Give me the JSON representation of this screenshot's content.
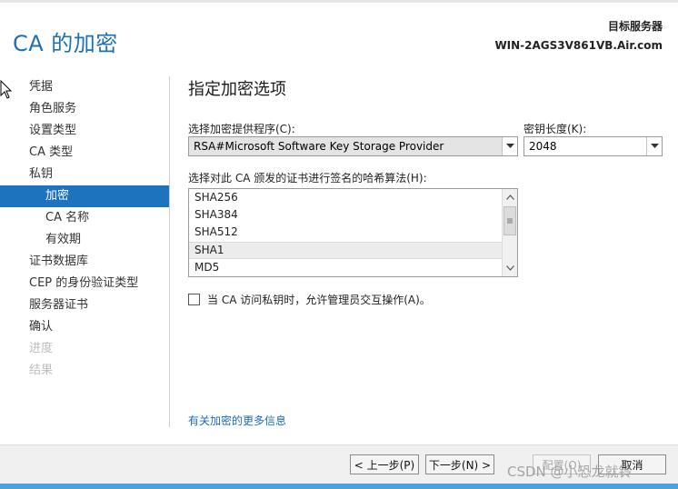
{
  "window": {
    "title": "CA 的加密",
    "target_server_label": "目标服务器",
    "target_server_name": "WIN-2AGS3V861VB.Air.com"
  },
  "sidebar": {
    "items": [
      {
        "label": "凭据",
        "state": "normal"
      },
      {
        "label": "角色服务",
        "state": "normal"
      },
      {
        "label": "设置类型",
        "state": "normal"
      },
      {
        "label": "CA 类型",
        "state": "normal"
      },
      {
        "label": "私钥",
        "state": "normal"
      },
      {
        "label": "加密",
        "state": "active"
      },
      {
        "label": "CA 名称",
        "state": "normal"
      },
      {
        "label": "有效期",
        "state": "normal"
      },
      {
        "label": "证书数据库",
        "state": "normal"
      },
      {
        "label": "CEP 的身份验证类型",
        "state": "normal"
      },
      {
        "label": "服务器证书",
        "state": "normal"
      },
      {
        "label": "确认",
        "state": "normal"
      },
      {
        "label": "进度",
        "state": "disabled"
      },
      {
        "label": "结果",
        "state": "disabled"
      }
    ]
  },
  "main": {
    "heading": "指定加密选项",
    "provider_label": "选择加密提供程序(C):",
    "provider_value": "RSA#Microsoft Software Key Storage Provider",
    "key_length_label": "密钥长度(K):",
    "key_length_value": "2048",
    "hash_label": "选择对此 CA 颁发的证书进行签名的哈希算法(H):",
    "hash_options": [
      "SHA256",
      "SHA384",
      "SHA512",
      "SHA1",
      "MD5"
    ],
    "hash_selected": "SHA1",
    "allow_admin_label": "当 CA 访问私钥时，允许管理员交互操作(A)。",
    "allow_admin_checked": false,
    "more_info_link": "有关加密的更多信息"
  },
  "footer": {
    "prev_button": "< 上一步(P)",
    "next_button": "下一步(N) >",
    "configure_button": "配置(O)",
    "cancel_button": "取消"
  },
  "watermark": "CSDN @小恐龙就铃",
  "colors": {
    "accent": "#1e73be",
    "title": "#1f6fb2",
    "link": "#1e6bb8",
    "footer_bg": "#f0f0f0",
    "bottom_strip": "#4aa3df"
  },
  "icons": {
    "dropdown": "chevron-down-icon",
    "scroll_up": "chevron-up-icon",
    "scroll_down": "chevron-down-icon",
    "cursor": "mouse-pointer-icon"
  }
}
